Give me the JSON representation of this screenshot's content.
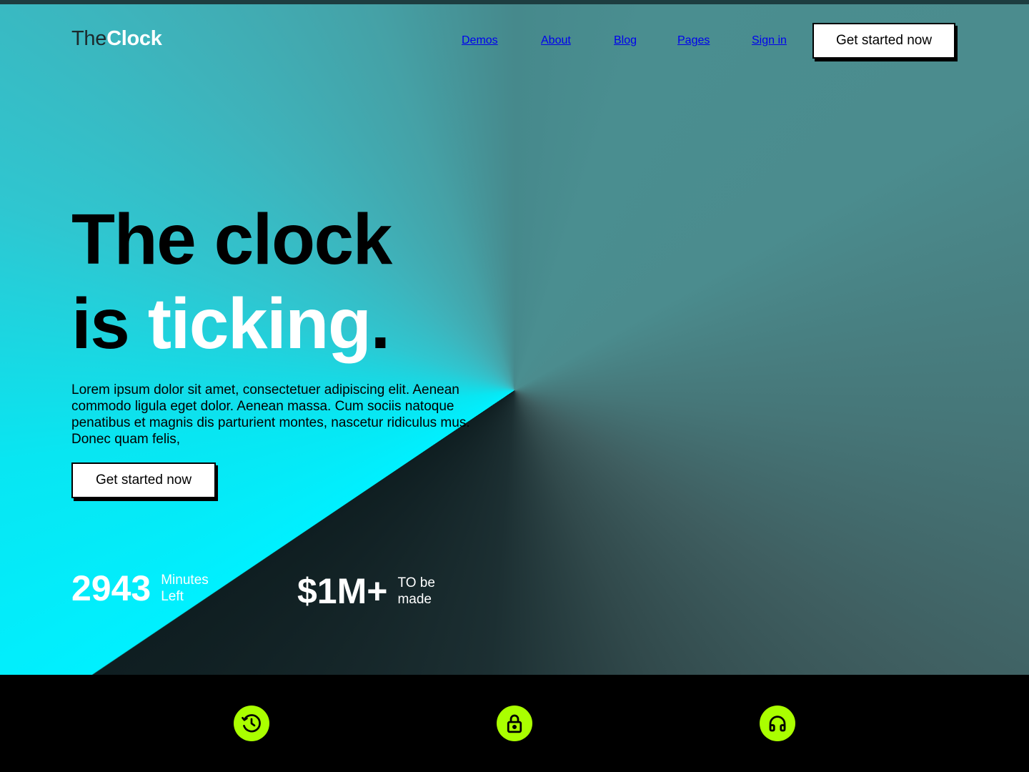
{
  "brand": {
    "part1": "The",
    "part2": "Clock"
  },
  "nav": {
    "items": [
      "Demos",
      "About",
      "Blog",
      "Pages",
      "Sign in"
    ],
    "cta_label": "Get started now"
  },
  "hero": {
    "headline_line1": "The clock",
    "headline_line2_prefix": "is ",
    "headline_line2_highlight": "ticking",
    "headline_line2_suffix": ".",
    "paragraph": "Lorem ipsum dolor sit amet, consectetuer adipiscing elit. Aenean commodo ligula eget dolor. Aenean massa. Cum sociis natoque penatibus et magnis dis parturient montes, nascetur ridiculus mus. Donec quam felis,",
    "cta_label": "Get started now"
  },
  "stats": [
    {
      "value": "2943",
      "label_line1": "Minutes",
      "label_line2": "Left"
    },
    {
      "value": "$1M+",
      "label_line1": "TO be",
      "label_line2": "made"
    }
  ],
  "footer_icons": [
    "clock-icon",
    "lock-icon",
    "headphones-icon"
  ],
  "colors": {
    "accent_cyan": "#00f0ff",
    "icon_green": "#aaff00",
    "footer_bg": "#000000",
    "text_dark": "#000000",
    "text_light": "#ffffff"
  }
}
